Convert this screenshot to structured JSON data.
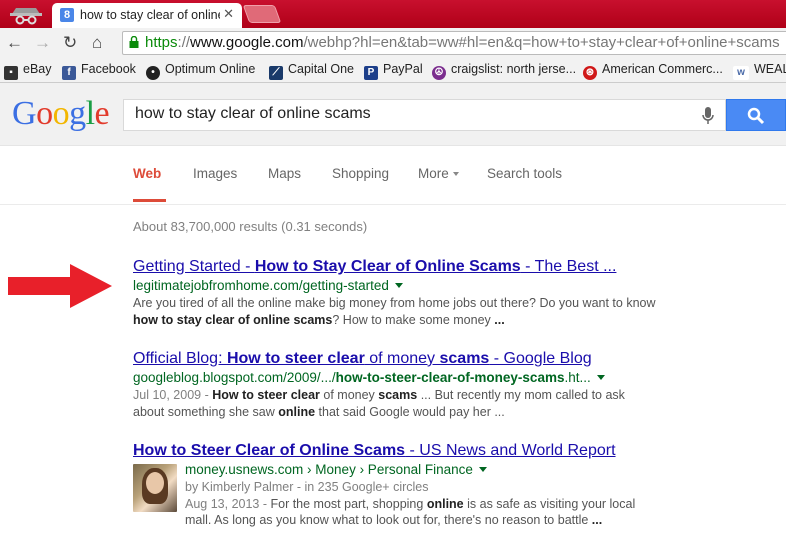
{
  "browser": {
    "tab_title": "how to stay clear of online",
    "tab_favicon": "8",
    "url_scheme": "https",
    "url_sep": "://",
    "url_host": "www.google.com",
    "url_path": "/webhp?hl=en&tab=ww#hl=en&q=how+to+stay+clear+of+online+scams",
    "bookmarks": [
      {
        "label": "eBay",
        "icon": "ebay-icon"
      },
      {
        "label": "Facebook",
        "icon": "facebook-icon"
      },
      {
        "label": "Optimum Online",
        "icon": "optimum-icon"
      },
      {
        "label": "Capital One",
        "icon": "capital-one-icon"
      },
      {
        "label": "PayPal",
        "icon": "paypal-icon"
      },
      {
        "label": "craigslist: north jerse...",
        "icon": "peace-icon"
      },
      {
        "label": "American Commerc...",
        "icon": "american-commerce-icon"
      },
      {
        "label": "WEALT",
        "icon": "wealth-icon"
      }
    ]
  },
  "google": {
    "logo": [
      "G",
      "o",
      "o",
      "g",
      "l",
      "e"
    ],
    "query": "how to stay clear of online scams",
    "tabs": [
      "Web",
      "Images",
      "Maps",
      "Shopping",
      "More",
      "Search tools"
    ],
    "stats": "About 83,700,000 results (0.31 seconds)"
  },
  "results": [
    {
      "title_a": "Getting Started - ",
      "title_b": "How to Stay Clear of Online Scams",
      "title_c": " - The Best ...",
      "cite": "legitimatejobfromhome.com/getting-started",
      "snippet_a": "Are you tired of all the online make big money from home jobs out there? Do you want to know ",
      "snippet_b": "how to stay clear of online scams",
      "snippet_c": "? How to make some money ",
      "snippet_d": "..."
    },
    {
      "title_a": "Official Blog: ",
      "title_b": "How to steer clear",
      "title_c": " of money ",
      "title_d": "scams",
      "title_e": " - Google Blog",
      "cite_a": "googleblog.blogspot.com/2009/.../",
      "cite_b": "how-to-steer-clear-of-money-scams",
      "cite_c": ".ht...",
      "date": "Jul 10, 2009 - ",
      "snippet_1": "How to steer clear",
      "snippet_2": " of money ",
      "snippet_3": "scams",
      "snippet_4": " ... But recently my mom called to ask about something she saw ",
      "snippet_5": "online",
      "snippet_6": " that said Google would pay her ..."
    },
    {
      "title_a": "How to Steer Clear of Online Scams",
      "title_b": " - US News and World Report",
      "cite": "money.usnews.com › Money › Personal Finance",
      "author": "by Kimberly Palmer - in 235 Google+ circles",
      "date": "Aug 13, 2013 - ",
      "snippet_a": "For the most part, shopping ",
      "snippet_b": "online",
      "snippet_c": " is as safe as visiting your local mall. As long as you know what to look out for, there's no reason to battle ",
      "snippet_d": "..."
    }
  ],
  "colors": {
    "chrome_red": "#c8102e",
    "link": "#1a0dab",
    "cite": "#006621",
    "active_tab": "#dd4b39",
    "search_button": "#4a8af4",
    "annotation_arrow": "#e8202a"
  }
}
